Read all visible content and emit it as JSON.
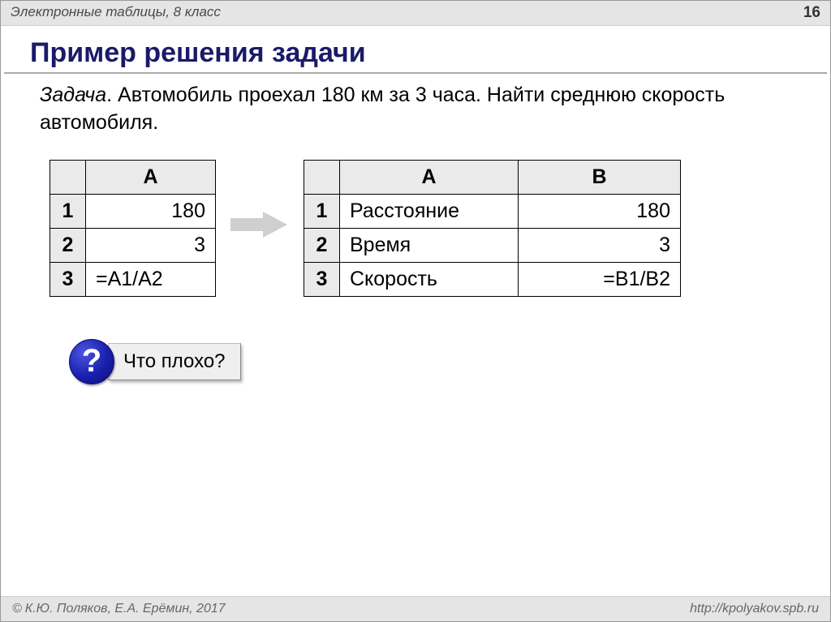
{
  "header": {
    "subject": "Электронные таблицы, 8 класс",
    "page": "16"
  },
  "title": "Пример решения задачи",
  "task": {
    "label": "Задача",
    "text": ". Автомобиль проехал 180 км за 3 часа. Найти среднюю скорость автомобиля."
  },
  "table1": {
    "cols": [
      "A"
    ],
    "rows": [
      {
        "n": "1",
        "a": "180"
      },
      {
        "n": "2",
        "a": "3"
      },
      {
        "n": "3",
        "a": "=A1/A2"
      }
    ]
  },
  "table2": {
    "cols": [
      "A",
      "B"
    ],
    "rows": [
      {
        "n": "1",
        "a": "Расстояние",
        "b": "180"
      },
      {
        "n": "2",
        "a": "Время",
        "b": "3"
      },
      {
        "n": "3",
        "a": "Скорость",
        "b": "=B1/B2"
      }
    ]
  },
  "question": {
    "mark": "?",
    "text": "Что плохо?"
  },
  "footer": {
    "copyright": "К.Ю. Поляков, Е.А. Ерёмин, 2017",
    "url": "http://kpolyakov.spb.ru"
  }
}
